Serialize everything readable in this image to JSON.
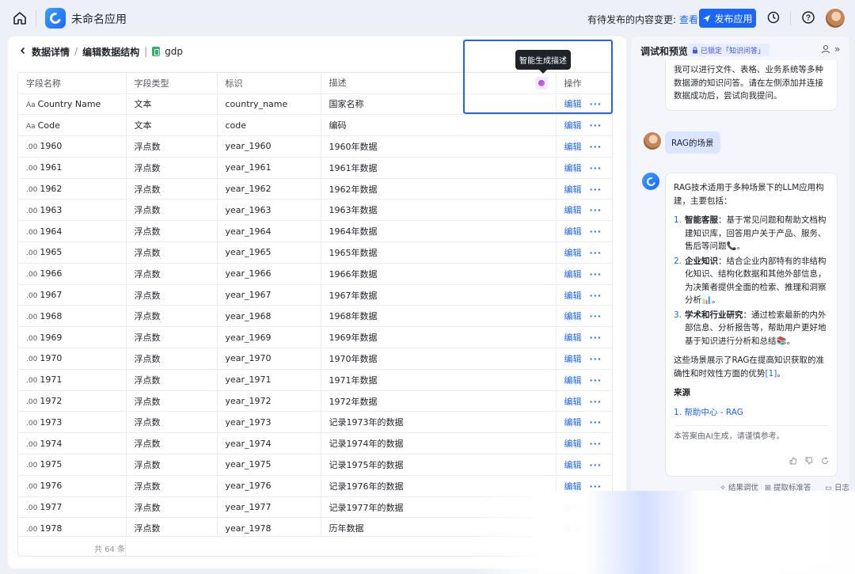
{
  "topbar": {
    "app_name": "未命名应用",
    "pending_text": "有待发布的内容变更:",
    "pending_link": "查看",
    "publish_label": "发布应用"
  },
  "breadcrumb": {
    "back": "数据详情",
    "middle": "编辑数据结构",
    "current": "gdp"
  },
  "table": {
    "headers": {
      "name": "字段名称",
      "type": "字段类型",
      "id": "标识",
      "desc": "描述",
      "op": "操作"
    },
    "rows": [
      {
        "icon": "Aa",
        "name": "Country Name",
        "type": "文本",
        "id": "country_name",
        "desc": "国家名称"
      },
      {
        "icon": "Aa",
        "name": "Code",
        "type": "文本",
        "id": "code",
        "desc": "编码"
      },
      {
        "icon": ".00",
        "name": "1960",
        "type": "浮点数",
        "id": "year_1960",
        "desc": "1960年数据"
      },
      {
        "icon": ".00",
        "name": "1961",
        "type": "浮点数",
        "id": "year_1961",
        "desc": "1961年数据"
      },
      {
        "icon": ".00",
        "name": "1962",
        "type": "浮点数",
        "id": "year_1962",
        "desc": "1962年数据"
      },
      {
        "icon": ".00",
        "name": "1963",
        "type": "浮点数",
        "id": "year_1963",
        "desc": "1963年数据"
      },
      {
        "icon": ".00",
        "name": "1964",
        "type": "浮点数",
        "id": "year_1964",
        "desc": "1964年数据"
      },
      {
        "icon": ".00",
        "name": "1965",
        "type": "浮点数",
        "id": "year_1965",
        "desc": "1965年数据"
      },
      {
        "icon": ".00",
        "name": "1966",
        "type": "浮点数",
        "id": "year_1966",
        "desc": "1966年数据"
      },
      {
        "icon": ".00",
        "name": "1967",
        "type": "浮点数",
        "id": "year_1967",
        "desc": "1967年数据"
      },
      {
        "icon": ".00",
        "name": "1968",
        "type": "浮点数",
        "id": "year_1968",
        "desc": "1968年数据"
      },
      {
        "icon": ".00",
        "name": "1969",
        "type": "浮点数",
        "id": "year_1969",
        "desc": "1969年数据"
      },
      {
        "icon": ".00",
        "name": "1970",
        "type": "浮点数",
        "id": "year_1970",
        "desc": "1970年数据"
      },
      {
        "icon": ".00",
        "name": "1971",
        "type": "浮点数",
        "id": "year_1971",
        "desc": "1971年数据"
      },
      {
        "icon": ".00",
        "name": "1972",
        "type": "浮点数",
        "id": "year_1972",
        "desc": "1972年数据"
      },
      {
        "icon": ".00",
        "name": "1973",
        "type": "浮点数",
        "id": "year_1973",
        "desc": "记录1973年的数据"
      },
      {
        "icon": ".00",
        "name": "1974",
        "type": "浮点数",
        "id": "year_1974",
        "desc": "记录1974年的数据"
      },
      {
        "icon": ".00",
        "name": "1975",
        "type": "浮点数",
        "id": "year_1975",
        "desc": "记录1975年的数据"
      },
      {
        "icon": ".00",
        "name": "1976",
        "type": "浮点数",
        "id": "year_1976",
        "desc": "记录1976年的数据"
      },
      {
        "icon": ".00",
        "name": "1977",
        "type": "浮点数",
        "id": "year_1977",
        "desc": "记录1977年的数据"
      },
      {
        "icon": ".00",
        "name": "1978",
        "type": "浮点数",
        "id": "year_1978",
        "desc": "历年数据"
      }
    ],
    "edit_label": "编辑",
    "more_label": "···",
    "total": "共 64 条"
  },
  "tooltip": "智能生成描述",
  "preview": {
    "title": "调试和预览",
    "badge": "已锁定「知识问答」",
    "bot_msg_1": "我可以进行文件、表格、业务系统等多种数据源的知识问答。请在左侧添加并连接数据成功后，尝试向我提问。",
    "user_msg": "RAG的场景",
    "answer_intro": "RAG技术适用于多种场景下的LLM应用构建，主要包括：",
    "answer_items": [
      {
        "num": "1.",
        "title": "智能客服",
        "text": "：基于常见问题和帮助文档构建知识库，回答用户关于产品、服务、售后等问题📞。"
      },
      {
        "num": "2.",
        "title": "企业知识",
        "text": "：结合企业内部特有的非结构化知识、结构化数据和其他外部信息，为决策者提供全面的检索、推理和洞察分析📊。"
      },
      {
        "num": "3.",
        "title": "学术和行业研究",
        "text": "：通过检索最新的内外部信息、分析报告等，帮助用户更好地基于知识进行分析和总结📚。"
      }
    ],
    "answer_summary": "这些场景展示了RAG在提高知识获取的准确性和时效性方面的优势",
    "answer_ref": "[1]",
    "answer_summary_end": "。",
    "source_title": "来源",
    "source_num": "1.",
    "source_link": "帮助中心 - RAG",
    "ai_note": "本答案由AI生成，请谨慎参考。",
    "bottom_links": [
      "结果调优",
      "提取标准答案",
      "日志"
    ]
  },
  "colors": {
    "accent": "#1a66ff",
    "highlight_box": "#2563eb",
    "tooltip_bg": "#1f2329"
  }
}
